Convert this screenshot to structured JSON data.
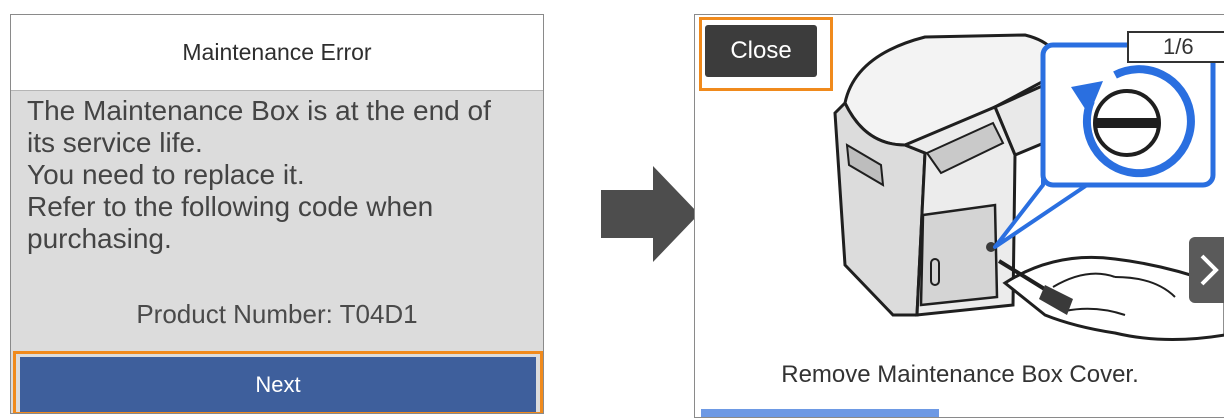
{
  "error_screen": {
    "title": "Maintenance Error",
    "message_lines": [
      "The Maintenance Box is at the end of",
      "its service life.",
      "You need to replace it.",
      "Refer to the following code when",
      "purchasing."
    ],
    "product_number": "Product Number: T04D1",
    "next_label": "Next"
  },
  "transition": {
    "icon": "right-arrow-icon"
  },
  "guide_screen": {
    "close_label": "Close",
    "page_indicator": "1/6",
    "next_icon": "chevron-right-icon",
    "caption": "Remove Maintenance Box Cover.",
    "progress_fraction": 0.46
  },
  "colors": {
    "highlight": "#f08a1c",
    "next_button": "#3e5f9c",
    "callout_blue": "#2a6fe0",
    "progress": "#6d99e4",
    "error_background": "#dcdcdc"
  }
}
